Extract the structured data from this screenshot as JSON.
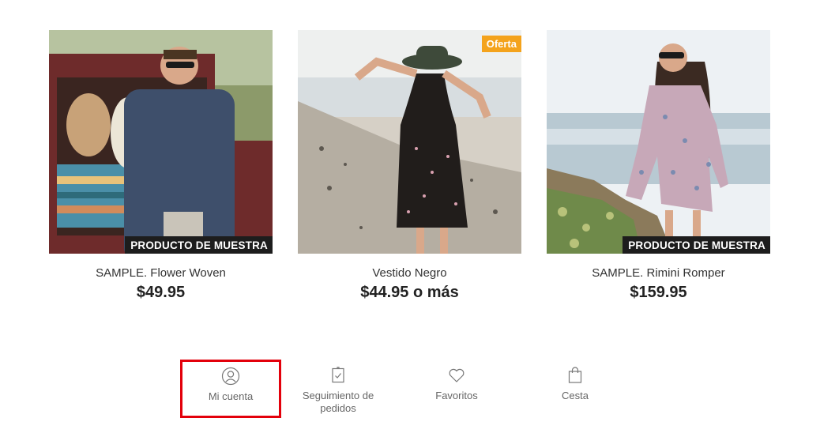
{
  "products": [
    {
      "name": "SAMPLE. Flower Woven",
      "price": "$49.95",
      "badge": "PRODUCTO DE MUESTRA"
    },
    {
      "name": "Vestido Negro",
      "price": "$44.95 o más",
      "sale_badge": "Oferta"
    },
    {
      "name": "SAMPLE. Rimini Romper",
      "price": "$159.95",
      "badge": "PRODUCTO DE MUESTRA"
    }
  ],
  "bottom_nav": [
    {
      "label": "Mi cuenta",
      "icon": "user-circle-icon",
      "highlighted": true
    },
    {
      "label": "Seguimiento de pedidos",
      "icon": "clipboard-check-icon"
    },
    {
      "label": "Favoritos",
      "icon": "heart-icon"
    },
    {
      "label": "Cesta",
      "icon": "shopping-bag-icon"
    }
  ],
  "colors": {
    "highlight_border": "#e3000b",
    "sale_badge": "#f4a31c",
    "sample_badge": "#1d1d1d"
  }
}
